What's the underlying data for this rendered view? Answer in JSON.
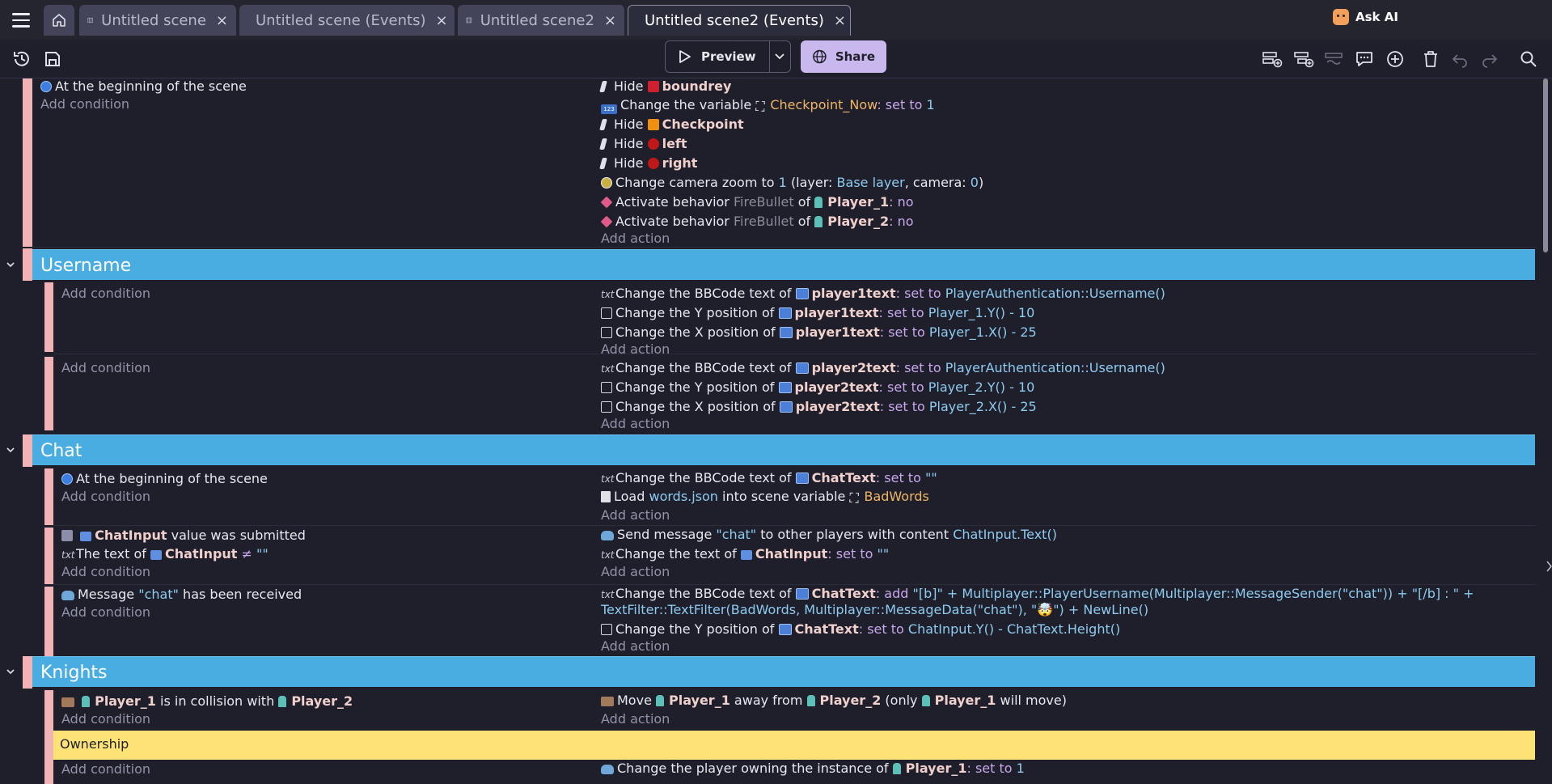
{
  "tabs": {
    "home_icon": "home-icon",
    "items": [
      {
        "label": "Untitled scene",
        "icon": "scene-icon"
      },
      {
        "label": "Untitled scene (Events)",
        "icon": "events-icon"
      },
      {
        "label": "Untitled scene2",
        "icon": "scene-icon"
      },
      {
        "label": "Untitled scene2 (Events)",
        "icon": "events-icon",
        "active": true
      }
    ],
    "close_glyph": "×",
    "ask_ai": "Ask AI"
  },
  "toolbar": {
    "preview_label": "Preview",
    "share_label": "Share"
  },
  "common": {
    "add_condition": "Add condition",
    "add_action": "Add action"
  },
  "event1": {
    "condition": "At the beginning of the scene",
    "hide": "Hide",
    "boundrey": "boundrey",
    "change_variable": "Change the variable",
    "checkpoint_now": "Checkpoint_Now",
    "set_to": ": set to",
    "one": "1",
    "checkpoint": "Checkpoint",
    "left": "left",
    "right": "right",
    "camera_zoom_a": "Change camera zoom to",
    "camera_zoom_b": "(layer:",
    "base_layer": "Base layer",
    "camera_word": ", camera:",
    "zero": "0",
    "close_paren": ")",
    "activate_behavior": "Activate behavior",
    "firebullet": "FireBullet",
    "of": "of",
    "player1": "Player_1",
    "player2": "Player_2",
    "colon_no": ": no"
  },
  "username": {
    "title": "Username",
    "change_bbcode": "Change the BBCode text of",
    "change_y": "Change the Y position of",
    "change_x": "Change the X position of",
    "player1text": "player1text",
    "player2text": "player2text",
    "set_to": ": set to",
    "username_expr": "PlayerAuthentication::Username()",
    "p1_y": "Player_1.Y() - 10",
    "p1_x": "Player_1.X() - 25",
    "p2_y": "Player_2.Y() - 10",
    "p2_x": "Player_2.X() - 25"
  },
  "chat": {
    "title": "Chat",
    "begin": "At the beginning of the scene",
    "change_bbcode": "Change the BBCode text of",
    "chattext": "ChatText",
    "set_to": ": set to",
    "empty": "\"\"",
    "load": "Load",
    "words_json": "words.json",
    "into_scene_var": "into scene variable",
    "badwords": "BadWords",
    "chatinput": "ChatInput",
    "value_submitted": "value was submitted",
    "text_of": "The text of",
    "neq": "≠",
    "send_message": "Send message",
    "chat_str": "\"chat\"",
    "to_other_players": "to other players with content",
    "chatinput_text": "ChatInput.Text()",
    "change_text_of": "Change the text of",
    "message": "Message",
    "has_been_received": "has been received",
    "add_word": ": add",
    "bb_expr_line1": "\"[b]\" + Multiplayer::PlayerUsername(Multiplayer::MessageSender(\"chat\")) + \"[/b] : \" +",
    "bb_expr_line2": "TextFilter::TextFilter(BadWords, Multiplayer::MessageData(\"chat\"), \"🤯\") + NewLine()",
    "change_y": "Change the Y position of",
    "y_expr": "ChatInput.Y() - ChatText.Height()"
  },
  "knights": {
    "title": "Knights",
    "player1": "Player_1",
    "player2": "Player_2",
    "in_collision": "is in collision with",
    "move": "Move",
    "away_from": "away from",
    "only": "(only",
    "will_move": "will move)"
  },
  "ownership": {
    "title": "Ownership",
    "change_owner": "Change the player owning the instance of",
    "player1": "Player_1",
    "set_to": ": set to",
    "one": "1"
  }
}
